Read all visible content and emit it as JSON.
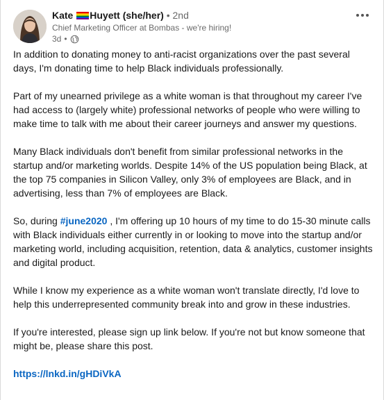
{
  "post": {
    "author": {
      "first_name": "Kate",
      "last_name_pronouns": "Huyett (she/her)",
      "separator": "•",
      "degree": "2nd",
      "headline": "Chief Marketing Officer at Bombas - we're hiring!",
      "time_ago": "3d",
      "meta_dot": "•",
      "visibility_icon": "globe-icon",
      "flag_icon": "rainbow-flag-icon"
    },
    "menu_icon": "more-options-icon",
    "paragraphs": [
      {
        "text": "In addition to donating money to anti-racist organizations over the past several days, I'm donating time to help Black individuals professionally."
      },
      {
        "text": "Part of my unearned privilege as a white woman is that throughout my career I've had access to (largely white) professional networks of people who were willing to make time to talk with me about their career journeys and answer my questions."
      },
      {
        "text": "Many Black individuals don't benefit from similar professional networks in the startup and/or marketing worlds. Despite 14% of the US population being Black, at the top 75 companies in Silicon Valley, only 3% of employees are Black, and in advertising, less than 7% of employees are Black."
      },
      {
        "before": "So, during ",
        "hashtag": "#june2020",
        "after": " , I'm offering up 10 hours of my time to do 15-30 minute calls with Black individuals either currently in or looking to move into the startup and/or marketing world, including acquisition, retention, data & analytics, customer insights and digital product."
      },
      {
        "text": "While I know my experience as a white woman won't translate directly, I'd love to help this underrepresented community break into and grow in these industries."
      },
      {
        "text": "If you're interested, please sign up link below. If you're not but know someone that might be, please share this post."
      }
    ],
    "link": "https://lnkd.in/gHDiVkA"
  },
  "colors": {
    "link": "#0a66c2",
    "text": "#000000e6",
    "secondary": "#00000099"
  }
}
